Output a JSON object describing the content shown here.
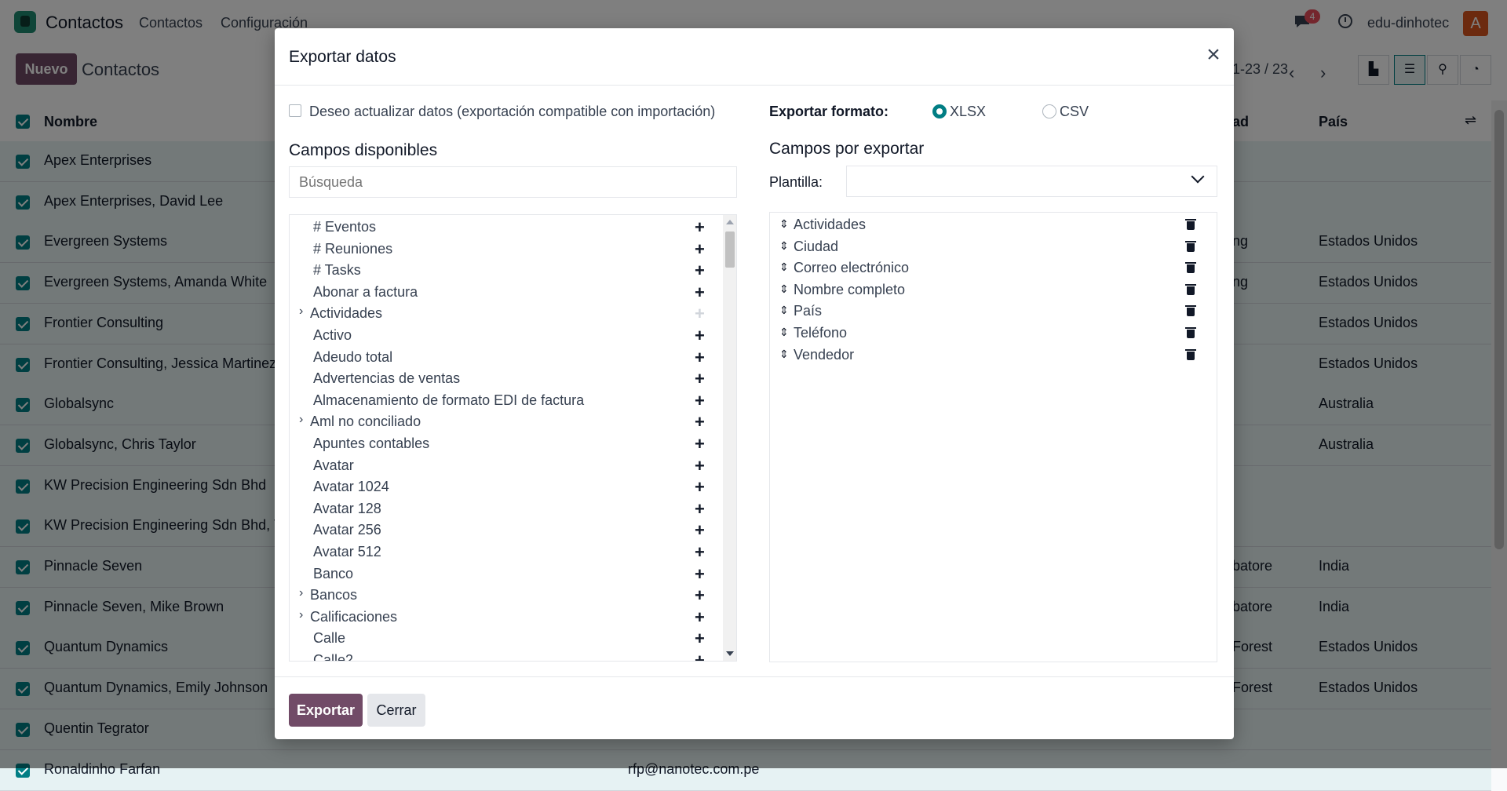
{
  "topbar": {
    "app_title": "Contactos",
    "menu": [
      "Contactos",
      "Configuración"
    ],
    "chat_badge": "4",
    "company": "edu-dinhotec",
    "avatar_letter": "A"
  },
  "control": {
    "new_label": "Nuevo",
    "breadcrumb": "Contactos",
    "pager": "1-23 / 23"
  },
  "list": {
    "headers": [
      "Nombre",
      "Ciudad",
      "País"
    ],
    "rows": [
      {
        "name": "Apex Enterprises",
        "city": "",
        "country": ""
      },
      {
        "name": "Apex Enterprises, David Lee",
        "city": "",
        "country": ""
      },
      {
        "name": "Evergreen Systems",
        "city": "ng",
        "country": "Estados Unidos"
      },
      {
        "name": "Evergreen Systems, Amanda White",
        "city": "ng",
        "country": "Estados Unidos"
      },
      {
        "name": "Frontier Consulting",
        "city": "",
        "country": "Estados Unidos"
      },
      {
        "name": "Frontier Consulting, Jessica Martinez",
        "city": "",
        "country": "Estados Unidos"
      },
      {
        "name": "Globalsync",
        "city": "",
        "country": "Australia"
      },
      {
        "name": "Globalsync, Chris Taylor",
        "city": "",
        "country": "Australia"
      },
      {
        "name": "KW Precision Engineering Sdn Bhd",
        "city": "",
        "country": ""
      },
      {
        "name": "KW Precision Engineering Sdn Bhd, To",
        "city": "",
        "country": ""
      },
      {
        "name": "Pinnacle Seven",
        "city": "batore",
        "country": "India"
      },
      {
        "name": "Pinnacle Seven, Mike Brown",
        "city": "batore",
        "country": "India"
      },
      {
        "name": "Quantum Dynamics",
        "city": "Forest",
        "country": "Estados Unidos"
      },
      {
        "name": "Quantum Dynamics, Emily Johnson",
        "city": "Forest",
        "country": "Estados Unidos"
      },
      {
        "name": "Quentin Tegrator",
        "city": "",
        "country": ""
      },
      {
        "name": "Ronaldinho Farfan",
        "city": "",
        "country": "",
        "email": "rfp@nanotec.com.pe"
      }
    ]
  },
  "modal": {
    "title": "Exportar datos",
    "compat_label": "Deseo actualizar datos (exportación compatible con importación)",
    "format_label": "Exportar formato:",
    "formats": [
      "XLSX",
      "CSV"
    ],
    "available_heading": "Campos disponibles",
    "search_placeholder": "Búsqueda",
    "export_heading": "Campos por exportar",
    "template_label": "Plantilla:",
    "available_fields": [
      {
        "label": "# Eventos",
        "expandable": false
      },
      {
        "label": "# Reuniones",
        "expandable": false
      },
      {
        "label": "# Tasks",
        "expandable": false
      },
      {
        "label": "Abonar a factura",
        "expandable": false
      },
      {
        "label": "Actividades",
        "expandable": true,
        "added": true
      },
      {
        "label": "Activo",
        "expandable": false
      },
      {
        "label": "Adeudo total",
        "expandable": false
      },
      {
        "label": "Advertencias de ventas",
        "expandable": false
      },
      {
        "label": "Almacenamiento de formato EDI de factura",
        "expandable": false
      },
      {
        "label": "Aml no conciliado",
        "expandable": true
      },
      {
        "label": "Apuntes contables",
        "expandable": false
      },
      {
        "label": "Avatar",
        "expandable": false
      },
      {
        "label": "Avatar 1024",
        "expandable": false
      },
      {
        "label": "Avatar 128",
        "expandable": false
      },
      {
        "label": "Avatar 256",
        "expandable": false
      },
      {
        "label": "Avatar 512",
        "expandable": false
      },
      {
        "label": "Banco",
        "expandable": false
      },
      {
        "label": "Bancos",
        "expandable": true
      },
      {
        "label": "Calificaciones",
        "expandable": true
      },
      {
        "label": "Calle",
        "expandable": false
      },
      {
        "label": "Calle2",
        "expandable": false
      }
    ],
    "export_fields": [
      "Actividades",
      "Ciudad",
      "Correo electrónico",
      "Nombre completo",
      "País",
      "Teléfono",
      "Vendedor"
    ],
    "export_button": "Exportar",
    "close_button": "Cerrar"
  },
  "colors": {
    "primary": "#714b67",
    "accent": "#017e84"
  }
}
